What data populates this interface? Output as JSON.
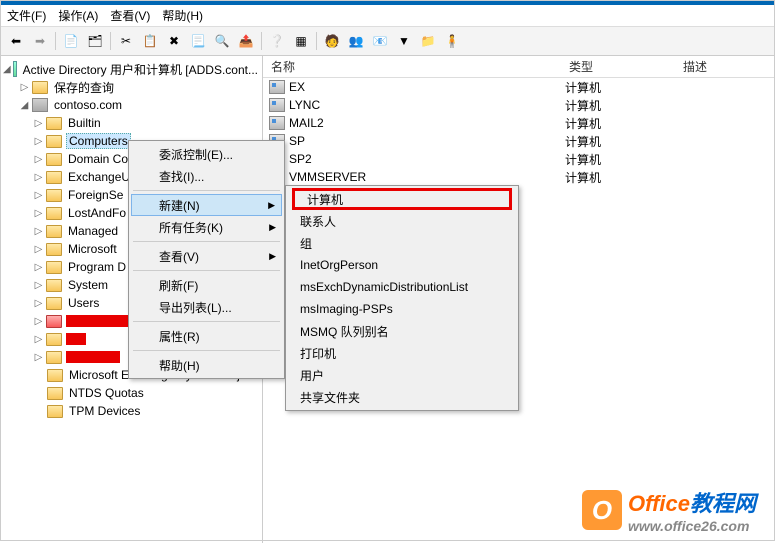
{
  "menubar": {
    "file": "文件(F)",
    "action": "操作(A)",
    "view": "查看(V)",
    "help": "帮助(H)"
  },
  "title": "Active Directory 用户和计算机 [ADDS.cont...",
  "tree": {
    "saved": "保存的查询",
    "domain": "contoso.com",
    "nodes": [
      {
        "l": "Builtin"
      },
      {
        "l": "Computers",
        "sel": true
      },
      {
        "l": "Domain Co"
      },
      {
        "l": "ExchangeU"
      },
      {
        "l": "ForeignSe"
      },
      {
        "l": "LostAndFo"
      },
      {
        "l": "Managed "
      },
      {
        "l": "Microsoft "
      },
      {
        "l": "Program D"
      },
      {
        "l": "System"
      },
      {
        "l": "Users"
      }
    ],
    "extra": [
      "Microsoft Exchange System Object",
      "NTDS Quotas",
      "TPM Devices"
    ]
  },
  "list": {
    "cols": {
      "name": "名称",
      "type": "类型",
      "desc": "描述"
    },
    "rows": [
      {
        "n": "EX",
        "t": "计算机"
      },
      {
        "n": "LYNC",
        "t": "计算机"
      },
      {
        "n": "MAIL2",
        "t": "计算机"
      },
      {
        "n": "SP",
        "t": "计算机"
      },
      {
        "n": "SP2",
        "t": "计算机"
      },
      {
        "n": "VMMSERVER",
        "t": "计算机"
      }
    ]
  },
  "ctx1": [
    {
      "l": "委派控制(E)..."
    },
    {
      "l": "查找(I)..."
    },
    {
      "sep": true
    },
    {
      "l": "新建(N)",
      "hl": true,
      "sub": true
    },
    {
      "l": "所有任务(K)",
      "sub": true
    },
    {
      "sep": true
    },
    {
      "l": "查看(V)",
      "sub": true
    },
    {
      "sep": true
    },
    {
      "l": "刷新(F)"
    },
    {
      "l": "导出列表(L)..."
    },
    {
      "sep": true
    },
    {
      "l": "属性(R)"
    },
    {
      "sep": true
    },
    {
      "l": "帮助(H)"
    }
  ],
  "ctx2": [
    {
      "l": "计算机",
      "boxed": true
    },
    {
      "l": "联系人"
    },
    {
      "l": "组"
    },
    {
      "l": "InetOrgPerson"
    },
    {
      "l": "msExchDynamicDistributionList"
    },
    {
      "l": "msImaging-PSPs"
    },
    {
      "l": "MSMQ 队列别名"
    },
    {
      "l": "打印机"
    },
    {
      "l": "用户"
    },
    {
      "l": "共享文件夹"
    }
  ],
  "watermark": {
    "t1": "Office",
    "t2": "教程网",
    "url": "www.office26.com"
  },
  "redacted_widths": [
    70,
    20,
    54
  ]
}
